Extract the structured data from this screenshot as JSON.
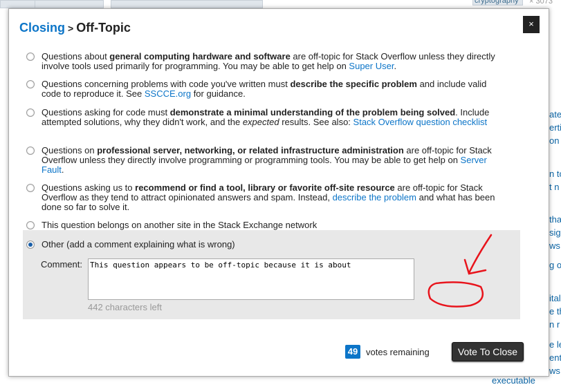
{
  "background": {
    "tab_label": "cryptography",
    "count": "× 3073",
    "right_fragments": [
      "ate",
      "erti",
      "on",
      "n to",
      "t n",
      "tha",
      "sig",
      "ws",
      "g o",
      "ital",
      "e th",
      "n r",
      "e le",
      "ent",
      "ws",
      "executable"
    ]
  },
  "dialog": {
    "breadcrumb": "Closing",
    "separator": ">",
    "title": "Off-Topic",
    "close_label": "×",
    "options": [
      {
        "parts": [
          [
            "Questions about ",
            ""
          ],
          [
            "general computing hardware and software",
            "b"
          ],
          [
            " are off-topic for Stack Overflow unless they directly involve tools used primarily for programming. You may be able to get help on ",
            ""
          ],
          [
            "Super User",
            "a"
          ],
          [
            ".",
            ""
          ]
        ]
      },
      {
        "parts": [
          [
            "Questions concerning problems with code you've written must ",
            ""
          ],
          [
            "describe the specific problem",
            "b"
          ],
          [
            " and include valid code to reproduce it. See ",
            ""
          ],
          [
            "SSCCE.org",
            "a"
          ],
          [
            " for guidance.",
            ""
          ]
        ]
      },
      {
        "parts": [
          [
            "Questions asking for code must ",
            ""
          ],
          [
            "demonstrate a minimal understanding of the problem being solved",
            "b"
          ],
          [
            ". Include attempted solutions, why they didn't work, and the ",
            ""
          ],
          [
            "expected",
            "i"
          ],
          [
            " results. See also: ",
            ""
          ],
          [
            "Stack Overflow question checklist",
            "a"
          ]
        ]
      },
      {
        "parts": [
          [
            "Questions on ",
            ""
          ],
          [
            "professional server, networking, or related infrastructure administration",
            "b"
          ],
          [
            " are off-topic for Stack Overflow unless they directly involve programming or programming tools. You may be able to get help on ",
            ""
          ],
          [
            "Server Fault",
            "a"
          ],
          [
            ".",
            ""
          ]
        ]
      },
      {
        "parts": [
          [
            "Questions asking us to ",
            ""
          ],
          [
            "recommend or find a tool, library or favorite off-site resource",
            "b"
          ],
          [
            " are off-topic for Stack Overflow as they tend to attract opinionated answers and spam. Instead, ",
            ""
          ],
          [
            "describe the problem",
            "a"
          ],
          [
            " and what has been done so far to solve it.",
            ""
          ]
        ]
      },
      {
        "parts": [
          [
            "This question belongs on another site in the Stack Exchange network",
            ""
          ]
        ]
      },
      {
        "parts": [
          [
            "Other (add a comment explaining what is wrong)",
            ""
          ]
        ],
        "selected": true
      }
    ],
    "comment_label": "Comment:",
    "comment_value": "This question appears to be off-topic because it is about",
    "chars_left": "442 characters left",
    "votes_count": "49",
    "votes_label": "votes remaining",
    "vote_button": "Vote To Close"
  },
  "colors": {
    "accent": "#0c75c8",
    "annotation": "#e8141c"
  }
}
